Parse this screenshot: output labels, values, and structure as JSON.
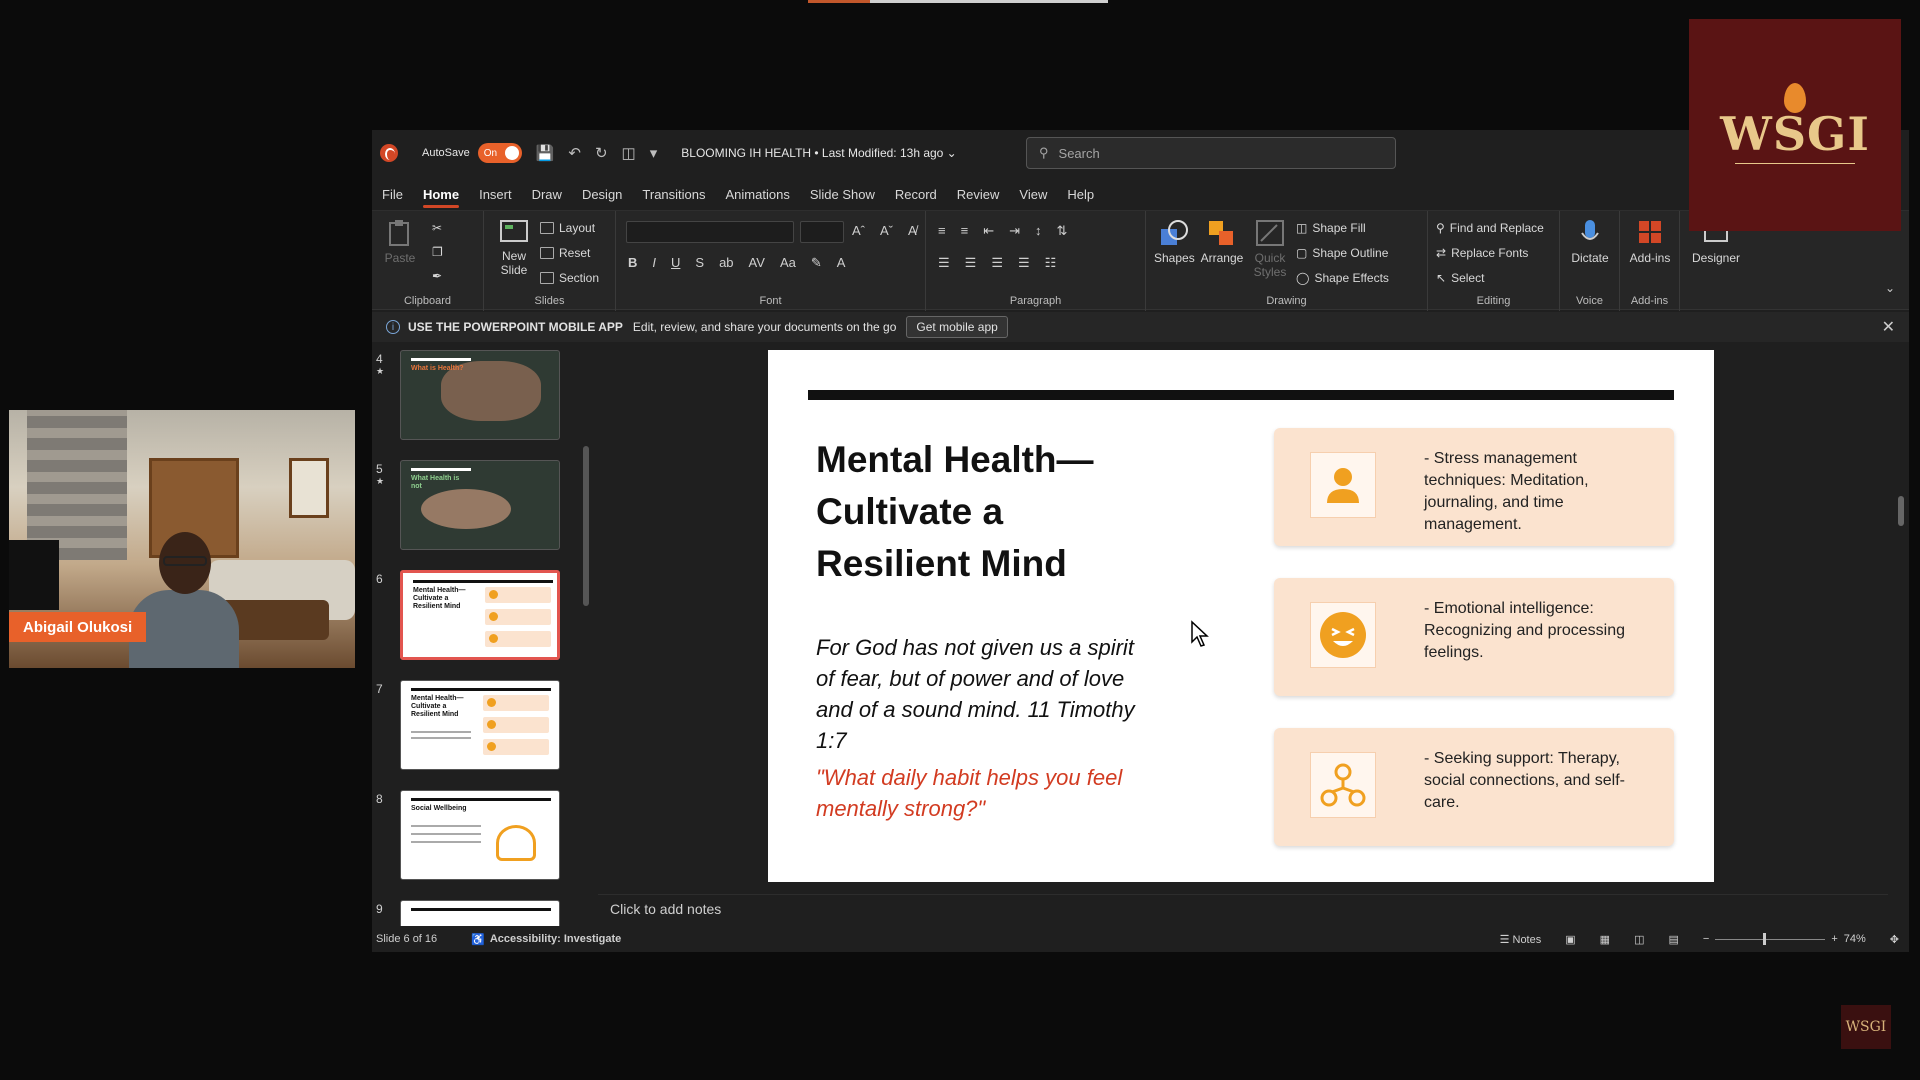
{
  "titlebar": {
    "autosave_label": "AutoSave",
    "autosave_state": "On",
    "document_title": "BLOOMING IH HEALTH • Last Modified: 13h ago ⌄",
    "search_placeholder": "Search"
  },
  "tabs": [
    "File",
    "Home",
    "Insert",
    "Draw",
    "Design",
    "Transitions",
    "Animations",
    "Slide Show",
    "Record",
    "Review",
    "View",
    "Help"
  ],
  "ribbon": {
    "clipboard": {
      "paste": "Paste",
      "label": "Clipboard"
    },
    "slides": {
      "new_slide": "New Slide",
      "layout": "Layout",
      "reset": "Reset",
      "section": "Section",
      "label": "Slides"
    },
    "font": {
      "label": "Font"
    },
    "paragraph": {
      "label": "Paragraph"
    },
    "drawing": {
      "shapes": "Shapes",
      "arrange": "Arrange",
      "quick_styles": "Quick Styles",
      "shape_fill": "Shape Fill",
      "shape_outline": "Shape Outline",
      "shape_effects": "Shape Effects",
      "label": "Drawing"
    },
    "editing": {
      "find_replace": "Find and Replace",
      "replace_fonts": "Replace Fonts",
      "select": "Select",
      "label": "Editing"
    },
    "voice": {
      "dictate": "Dictate",
      "label": "Voice"
    },
    "addins": {
      "addins": "Add-ins",
      "label": "Add-ins"
    },
    "designer": {
      "designer": "Designer"
    }
  },
  "infobar": {
    "title": "USE THE POWERPOINT MOBILE APP",
    "desc": "Edit, review, and share your documents on the go",
    "button": "Get mobile app"
  },
  "thumbnails": [
    {
      "number": "4",
      "title": "What is Health?"
    },
    {
      "number": "5",
      "title": "What Health is not"
    },
    {
      "number": "6",
      "title": "Mental Health— Cultivate a Resilient Mind"
    },
    {
      "number": "7",
      "title": "Mental Health— Cultivate a Resilient Mind"
    },
    {
      "number": "8",
      "title": "Social Wellbeing"
    },
    {
      "number": "9",
      "title": ""
    }
  ],
  "slide": {
    "title": "Mental Health— Cultivate a Resilient Mind",
    "verse_lines": [
      "For God has not given us a spirit",
      "of fear, but of power and of love",
      "and of a sound mind. 11 Timothy",
      "1:7"
    ],
    "question": "\"What daily habit helps you feel mentally strong?\"",
    "cards": [
      {
        "text": "- Stress management techniques: Meditation, journaling, and time management.",
        "icon": "person-icon"
      },
      {
        "text": "- Emotional intelligence: Recognizing and processing feelings.",
        "icon": "smiley-icon"
      },
      {
        "text": "- Seeking support: Therapy, social connections, and self-care.",
        "icon": "network-icon"
      }
    ]
  },
  "notes_placeholder": "Click to add notes",
  "statusbar": {
    "slide_info": "Slide 6 of 16",
    "accessibility": "Accessibility: Investigate",
    "notes": "Notes",
    "zoom": "74%"
  },
  "webcam": {
    "participant_name": "Abigail Olukosi"
  },
  "logo": {
    "mark": "WSGI",
    "small_mark": "WSGI"
  },
  "colors": {
    "accent": "#d24726",
    "toggle": "#e8612a",
    "card": "#fbe3cf",
    "question": "#d23b21",
    "logo_bg": "#5a1414"
  }
}
